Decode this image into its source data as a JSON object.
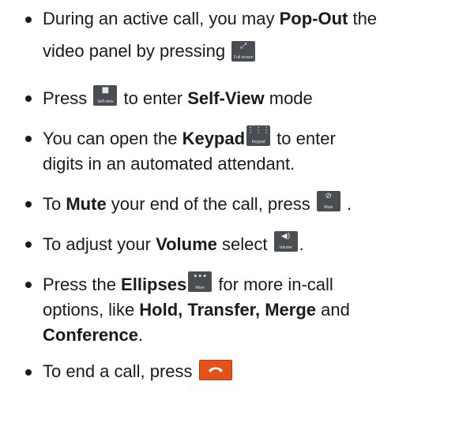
{
  "items": [
    {
      "t1": "During an active call, you may ",
      "b1": "Pop-Out",
      "t2": " the",
      "t3": "video panel by pressing ",
      "btn": {
        "icon": "expand-icon",
        "label": "Full screen"
      }
    },
    {
      "t1": "Press ",
      "btn": {
        "icon": "camera-icon",
        "label": "Self-view"
      },
      "t2": " to enter ",
      "b1": "Self-View",
      "t3": " mode"
    },
    {
      "t1": "You can open the ",
      "b1": "Keypad",
      "btn": {
        "icon": "keypad-icon",
        "label": "Keypad"
      },
      "t2": " to enter",
      "t3": "digits in an automated attendant."
    },
    {
      "t1": "To ",
      "b1": "Mute",
      "t2": " your end of the call, press ",
      "btn": {
        "icon": "mic-off-icon",
        "label": "Mute"
      },
      "t3": " ."
    },
    {
      "t1": "To adjust your ",
      "b1": "Volume",
      "t2": " select ",
      "btn": {
        "icon": "speaker-icon",
        "label": "Volume"
      },
      "t3": "."
    },
    {
      "t1": "Press the ",
      "b1": "Ellipses",
      "btn": {
        "icon": "more-icon",
        "label": "More"
      },
      "t2": "  for more in-call",
      "t3": "options, like ",
      "b2": "Hold, Transfer, Merge",
      "t4": " and",
      "b3": "Conference",
      "t5": "."
    },
    {
      "t1": "To end a call, press ",
      "btn": {
        "icon": "hang-up-icon",
        "label": "",
        "color": "#e4521b"
      }
    }
  ]
}
